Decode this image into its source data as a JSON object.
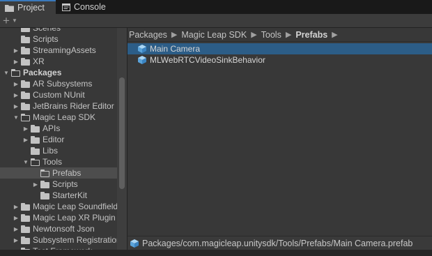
{
  "tabs": [
    {
      "label": "Project",
      "icon": "folder-icon",
      "active": true
    },
    {
      "label": "Console",
      "icon": "console-icon",
      "active": false
    }
  ],
  "toolbar": {
    "add_symbol": "+",
    "add_icon": "plus-icon"
  },
  "tree": [
    {
      "label": "Scenes",
      "depth": 1,
      "expandable": false,
      "expanded": false,
      "bold": false,
      "selected": false
    },
    {
      "label": "Scripts",
      "depth": 1,
      "expandable": false,
      "expanded": false,
      "bold": false,
      "selected": false
    },
    {
      "label": "StreamingAssets",
      "depth": 1,
      "expandable": true,
      "expanded": false,
      "bold": false,
      "selected": false
    },
    {
      "label": "XR",
      "depth": 1,
      "expandable": true,
      "expanded": false,
      "bold": false,
      "selected": false
    },
    {
      "label": "Packages",
      "depth": 0,
      "expandable": true,
      "expanded": true,
      "bold": true,
      "selected": false
    },
    {
      "label": "AR Subsystems",
      "depth": 1,
      "expandable": true,
      "expanded": false,
      "bold": false,
      "selected": false
    },
    {
      "label": "Custom NUnit",
      "depth": 1,
      "expandable": true,
      "expanded": false,
      "bold": false,
      "selected": false
    },
    {
      "label": "JetBrains Rider Editor",
      "depth": 1,
      "expandable": true,
      "expanded": false,
      "bold": false,
      "selected": false
    },
    {
      "label": "Magic Leap SDK",
      "depth": 1,
      "expandable": true,
      "expanded": true,
      "bold": false,
      "selected": false
    },
    {
      "label": "APIs",
      "depth": 2,
      "expandable": true,
      "expanded": false,
      "bold": false,
      "selected": false
    },
    {
      "label": "Editor",
      "depth": 2,
      "expandable": true,
      "expanded": false,
      "bold": false,
      "selected": false
    },
    {
      "label": "Libs",
      "depth": 2,
      "expandable": false,
      "expanded": false,
      "bold": false,
      "selected": false
    },
    {
      "label": "Tools",
      "depth": 2,
      "expandable": true,
      "expanded": true,
      "bold": false,
      "selected": false
    },
    {
      "label": "Prefabs",
      "depth": 3,
      "expandable": false,
      "expanded": true,
      "bold": false,
      "selected": true
    },
    {
      "label": "Scripts",
      "depth": 3,
      "expandable": true,
      "expanded": false,
      "bold": false,
      "selected": false
    },
    {
      "label": "StarterKit",
      "depth": 3,
      "expandable": false,
      "expanded": false,
      "bold": false,
      "selected": false
    },
    {
      "label": "Magic Leap Soundfield",
      "depth": 1,
      "expandable": true,
      "expanded": false,
      "bold": false,
      "selected": false
    },
    {
      "label": "Magic Leap XR Plugin",
      "depth": 1,
      "expandable": true,
      "expanded": false,
      "bold": false,
      "selected": false
    },
    {
      "label": "Newtonsoft Json",
      "depth": 1,
      "expandable": true,
      "expanded": false,
      "bold": false,
      "selected": false
    },
    {
      "label": "Subsystem Registration",
      "depth": 1,
      "expandable": true,
      "expanded": false,
      "bold": false,
      "selected": false
    },
    {
      "label": "Test Framework",
      "depth": 1,
      "expandable": true,
      "expanded": false,
      "bold": false,
      "selected": false
    }
  ],
  "breadcrumb": [
    "Packages",
    "Magic Leap SDK",
    "Tools",
    "Prefabs"
  ],
  "assets": [
    {
      "label": "Main Camera",
      "icon": "prefab-cube-icon",
      "selected": true
    },
    {
      "label": "MLWebRTCVideoSinkBehavior",
      "icon": "prefab-cube-icon",
      "selected": false
    }
  ],
  "status": {
    "path": "Packages/com.magicleap.unitysdk/Tools/Prefabs/Main Camera.prefab",
    "icon": "prefab-cube-icon"
  },
  "colors": {
    "accent": "#3a79bb",
    "selection": "#2c5d87",
    "panel": "#383838",
    "prefab": "#6fb4e8"
  }
}
